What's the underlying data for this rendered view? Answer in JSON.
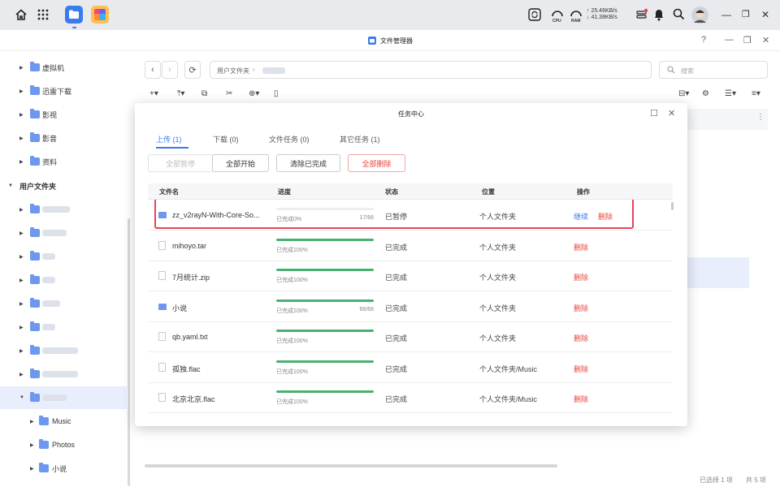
{
  "sysbar": {
    "net_up": "↑ 25.46KB/s",
    "net_down": "↓ 41.38KB/s",
    "cpu_label": "CPU",
    "ram_label": "RAM"
  },
  "window": {
    "title": "文件管理器",
    "help": "?",
    "minimize": "—",
    "restore": "❐",
    "close": "✕"
  },
  "sidebar": {
    "items": [
      {
        "label": "虚拟机"
      },
      {
        "label": "迅雷下载"
      },
      {
        "label": "影视"
      },
      {
        "label": "影音"
      },
      {
        "label": "资料"
      }
    ],
    "section_label": "用户文件夹",
    "sub_items": [
      {
        "label": "Music"
      },
      {
        "label": "Photos"
      },
      {
        "label": "小说"
      }
    ]
  },
  "toolbar": {
    "path_root": "用户文件夹",
    "search_placeholder": "搜索"
  },
  "status": {
    "selected": "已选择 1 项",
    "total": "共 5 项"
  },
  "task_center": {
    "title": "任务中心",
    "tabs": [
      {
        "label": "上传",
        "count": "(1)"
      },
      {
        "label": "下载",
        "count": "(0)"
      },
      {
        "label": "文件任务",
        "count": "(0)"
      },
      {
        "label": "其它任务",
        "count": "(1)"
      }
    ],
    "actions": {
      "pause_all": "全部暂停",
      "start_all": "全部开始",
      "clear_done": "清除已完成",
      "delete_all": "全部删除"
    },
    "columns": {
      "name": "文件名",
      "progress": "进度",
      "status": "状态",
      "location": "位置",
      "operation": "操作"
    },
    "resume_label": "继续",
    "delete_label": "删除",
    "rows": [
      {
        "name": "zz_v2rayN-With-Core-So...",
        "type": "folder",
        "progress": 0,
        "progress_text": "已完成0%",
        "count": "17/66",
        "status": "已暂停",
        "location": "个人文件夹"
      },
      {
        "name": "mihoyo.tar",
        "type": "file",
        "progress": 100,
        "progress_text": "已完成100%",
        "count": "",
        "status": "已完成",
        "location": "个人文件夹"
      },
      {
        "name": "7月统计.zip",
        "type": "file",
        "progress": 100,
        "progress_text": "已完成100%",
        "count": "",
        "status": "已完成",
        "location": "个人文件夹"
      },
      {
        "name": "小说",
        "type": "folder",
        "progress": 100,
        "progress_text": "已完成100%",
        "count": "66/66",
        "status": "已完成",
        "location": "个人文件夹"
      },
      {
        "name": "qb.yaml.txt",
        "type": "file",
        "progress": 100,
        "progress_text": "已完成100%",
        "count": "",
        "status": "已完成",
        "location": "个人文件夹"
      },
      {
        "name": "孤独.flac",
        "type": "file",
        "progress": 100,
        "progress_text": "已完成100%",
        "count": "",
        "status": "已完成",
        "location": "个人文件夹/Music"
      },
      {
        "name": "北京北京.flac",
        "type": "file",
        "progress": 100,
        "progress_text": "已完成100%",
        "count": "",
        "status": "已完成",
        "location": "个人文件夹/Music"
      }
    ]
  }
}
